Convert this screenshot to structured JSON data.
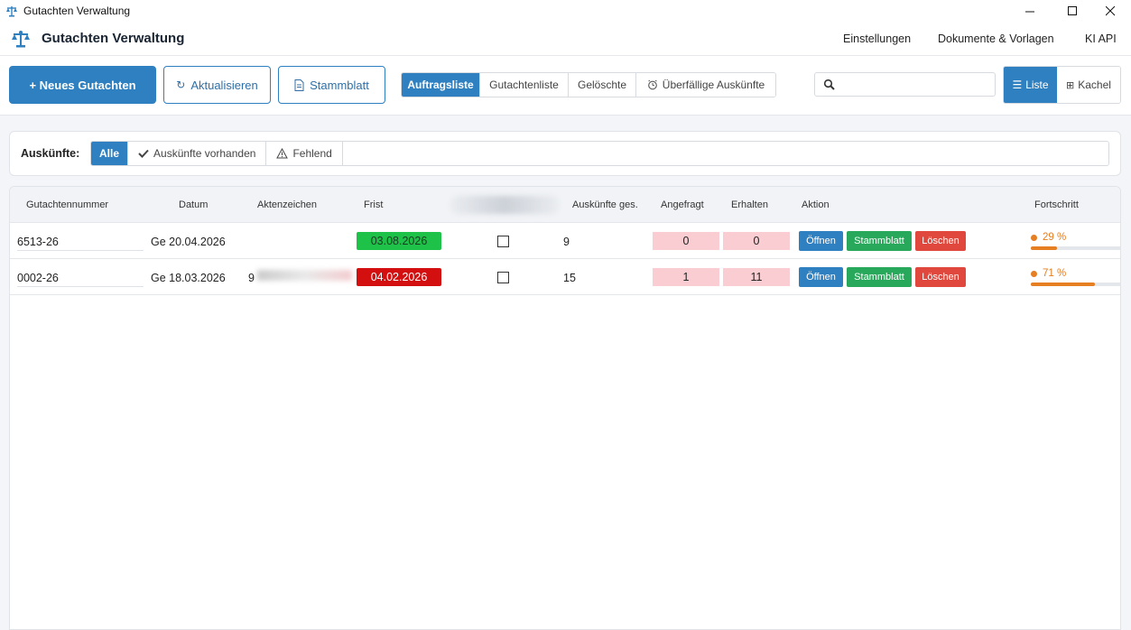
{
  "window": {
    "title": "Gutachten Verwaltung",
    "controls": [
      "—",
      "☐",
      "✕"
    ]
  },
  "app": {
    "title": "Gutachten Verwaltung",
    "nav": [
      "Einstellungen",
      "Dokumente & Vorlagen",
      "KI API"
    ]
  },
  "toolbar": {
    "new_label": "+ Neues Gutachten",
    "refresh_label": "Aktualisieren",
    "refresh_icon": "↻",
    "stammblatt_label": "Stammblatt",
    "tabs": [
      "Auftragsliste",
      "Gutachtenliste",
      "Gelöschte",
      "Überfällige Auskünfte"
    ],
    "search_placeholder": "",
    "view_list": "Liste",
    "view_list_icon": "☰",
    "view_tiles": "Kachel",
    "view_tiles_icon": "⊞"
  },
  "filter": {
    "label": "Auskünfte:",
    "options": [
      "Alle",
      "Auskünfte vorhanden",
      "Fehlend"
    ]
  },
  "table": {
    "headers": {
      "nummer": "Gutachtennummer",
      "datum": "Datum",
      "akten": "Aktenzeichen",
      "frist": "Frist",
      "ausk_ges": "Auskünfte ges.",
      "angefragt": "Angefragt",
      "erhalten": "Erhalten",
      "aktion": "Aktion",
      "fortschritt": "Fortschritt"
    },
    "actions": {
      "open": "Öffnen",
      "sheet": "Stammblatt",
      "delete": "Löschen"
    },
    "rows": [
      {
        "nummer": "6513-26",
        "datum": "Ge 20.04.2026",
        "akten": "",
        "frist": "03.08.2026",
        "frist_color": "#1ec248",
        "frist_text_color": "#1a3a22",
        "ausk_ges": "9",
        "angefragt": "0",
        "erhalten": "0",
        "fortschritt": "29 %",
        "progress_value": 29
      },
      {
        "nummer": "0002-26",
        "datum": "Ge 18.03.2026",
        "akten": "9",
        "frist": "04.02.2026",
        "frist_color": "#d40f0f",
        "frist_text_color": "#ffffff",
        "ausk_ges": "15",
        "angefragt": "1",
        "erhalten": "11",
        "fortschritt": "71 %",
        "progress_value": 71
      }
    ]
  },
  "colors": {
    "accent": "#2f80c1",
    "success": "#27a85a",
    "danger": "#e0483d",
    "progress": "#e67e22"
  }
}
